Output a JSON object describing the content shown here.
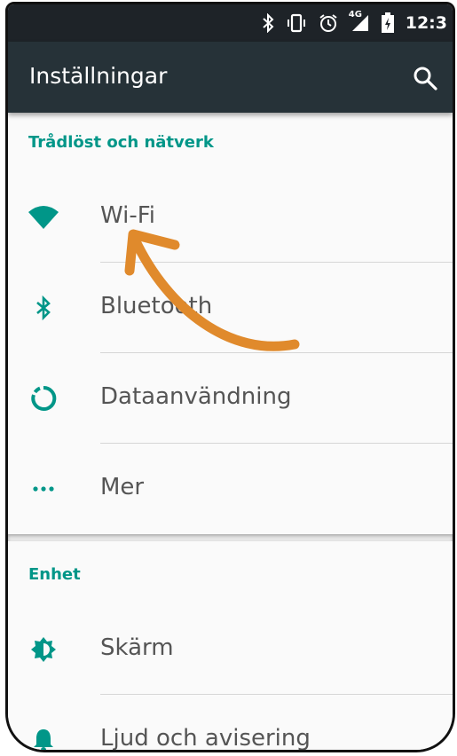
{
  "status_bar": {
    "bluetooth_icon": "bluetooth-icon",
    "vibrate_icon": "vibrate-icon",
    "alarm_icon": "alarm-icon",
    "network_label": "4G",
    "time": "12:3"
  },
  "app_bar": {
    "title": "Inställningar",
    "search_icon": "search-icon"
  },
  "sections": [
    {
      "header": "Trådlöst och nätverk",
      "items": [
        {
          "label": "Wi-Fi",
          "icon": "wifi-icon"
        },
        {
          "label": "Bluetooth",
          "icon": "bluetooth-icon"
        },
        {
          "label": "Dataanvändning",
          "icon": "data-usage-icon"
        },
        {
          "label": "Mer",
          "icon": "more-icon"
        }
      ]
    },
    {
      "header": "Enhet",
      "items": [
        {
          "label": "Skärm",
          "icon": "brightness-icon"
        },
        {
          "label": "Ljud och avisering",
          "icon": "bell-icon"
        }
      ]
    }
  ],
  "colors": {
    "accent": "#009688",
    "appbar": "#263238",
    "statusbar": "#1e2328",
    "arrow": "#e08a2c"
  }
}
